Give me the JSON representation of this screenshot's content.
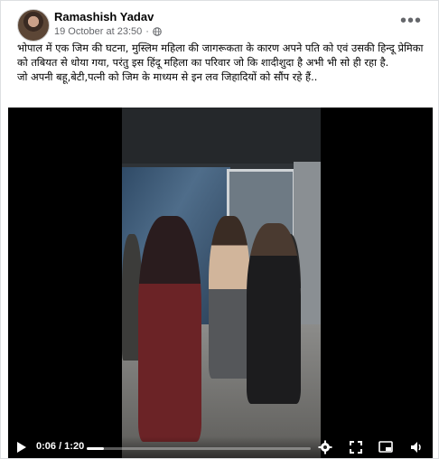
{
  "post": {
    "author": "Ramashish Yadav",
    "date": "19 October at 23:50",
    "separator": "·",
    "privacy_icon": "globe-icon",
    "more_icon": "more-options-icon",
    "more_glyph": "•••",
    "caption_lines": [
      "भोपाल में एक जिम की घटना, मुस्लिम महिला की जागरूकता के कारण अपने पति को एवं उसकी हिन्दू प्रेमिका को तबियत से धोया गया, परंतु इस हिंदू महिला का परिवार जो कि शादीशुदा है अभी भी सो ही रहा है.",
      "जो अपनी बहू,बेटी,पत्नी को जिम के माध्यम से इन लव जिहादियों को सौंप रहे हैं.."
    ]
  },
  "video": {
    "time_display": "0:06 / 1:20",
    "progress_fraction": 0.075,
    "play_icon": "play-icon",
    "settings_icon": "gear-icon",
    "fullscreen_icon": "fullscreen-icon",
    "pip_icon": "picture-in-picture-icon",
    "volume_icon": "volume-icon"
  },
  "colors": {
    "text_primary": "#050505",
    "text_secondary": "#65676b",
    "video_bg": "#000000"
  }
}
